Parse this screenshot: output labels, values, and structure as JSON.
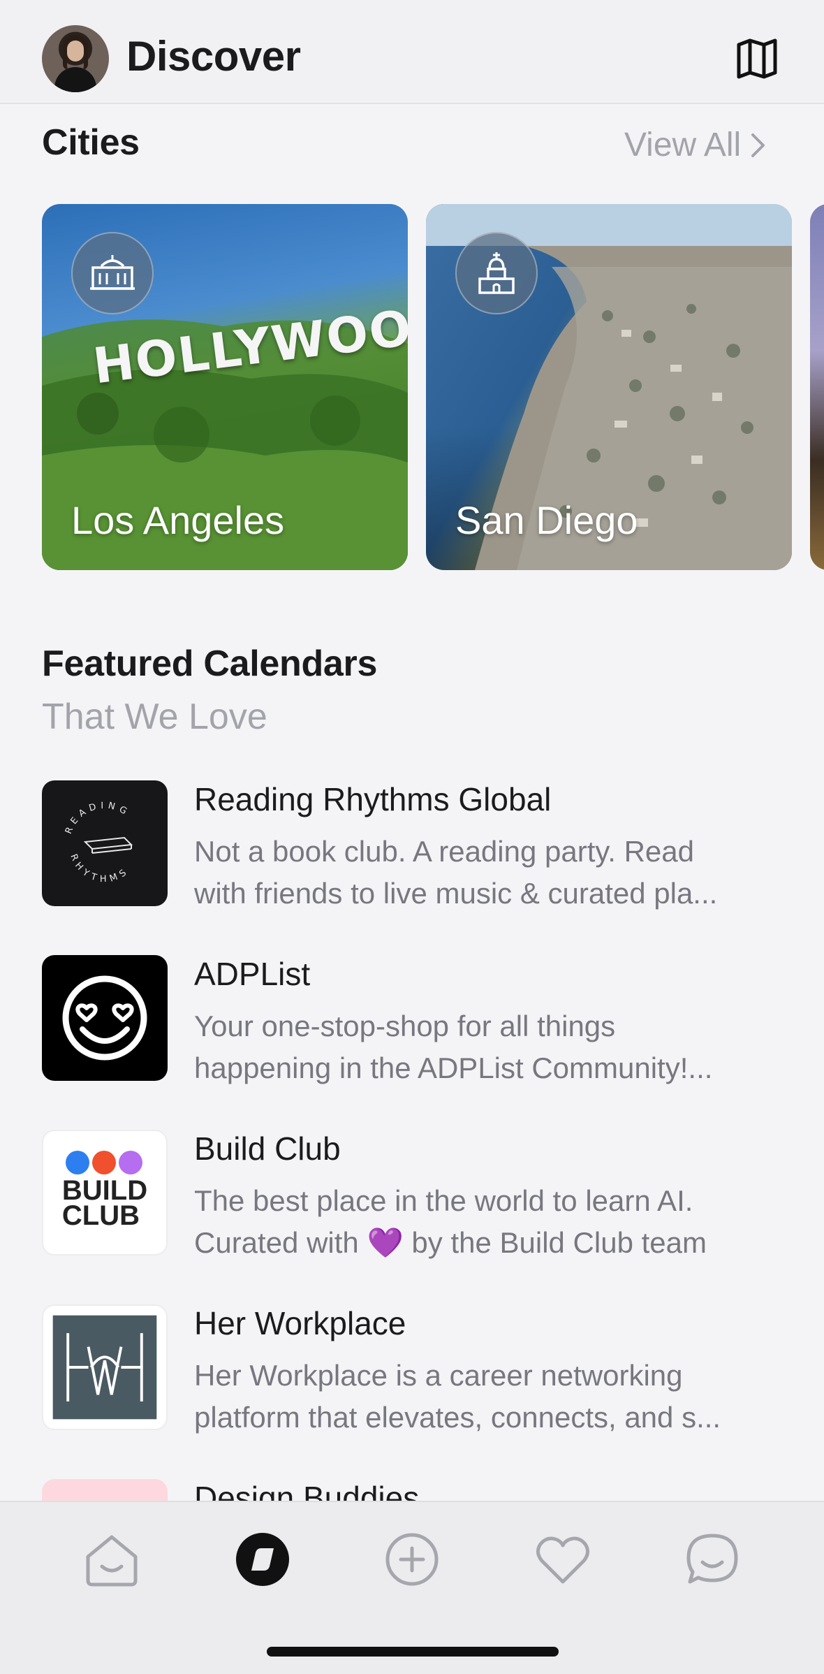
{
  "header": {
    "title": "Discover",
    "avatar_icon": "user-avatar",
    "map_icon": "map-icon"
  },
  "cities": {
    "title": "Cities",
    "view_all": "View All",
    "items": [
      {
        "name": "Los Angeles",
        "icon": "hollywood-landmark-icon",
        "sign_text": "HOLLYWOOD"
      },
      {
        "name": "San Diego",
        "icon": "mission-church-icon"
      }
    ]
  },
  "featured": {
    "title": "Featured Calendars",
    "subtitle": "That We Love",
    "items": [
      {
        "name": "Reading Rhythms Global",
        "desc_line1": "Not a book club. A reading party. Read",
        "desc_line2": "with friends to live music & curated pla...",
        "logo_text": "READING RHYTHMS"
      },
      {
        "name": "ADPList",
        "desc_line1": "Your one-stop-shop for all things",
        "desc_line2": "happening in the ADPList Community!...",
        "logo_icon": "heart-eyes-smiley-icon"
      },
      {
        "name": "Build Club",
        "desc_line1": "The best place in the world to learn AI.",
        "desc_line2": "Curated with 💜 by the Build Club team",
        "logo_line1": "BUILD",
        "logo_line2": "CLUB"
      },
      {
        "name": "Her Workplace",
        "desc_line1": "Her Workplace is a career networking",
        "desc_line2": "platform that elevates, connects, and s...",
        "logo_icon": "her-workplace-monogram-icon"
      },
      {
        "name": "Design Buddies",
        "desc_line1": "",
        "desc_line2": ""
      }
    ]
  },
  "tabbar": {
    "items": [
      {
        "name": "home",
        "icon": "home-icon",
        "active": false
      },
      {
        "name": "discover",
        "icon": "compass-icon",
        "active": true
      },
      {
        "name": "create",
        "icon": "plus-circle-icon",
        "active": false
      },
      {
        "name": "favorites",
        "icon": "heart-icon",
        "active": false
      },
      {
        "name": "chat",
        "icon": "chat-bubble-icon",
        "active": false
      }
    ]
  },
  "colors": {
    "background": "#f4f4f7",
    "text_primary": "#1b1b1d",
    "text_secondary": "#77777e",
    "muted": "#a3a3aa",
    "tab_inactive": "#a6a6ad",
    "tab_active": "#111111"
  }
}
